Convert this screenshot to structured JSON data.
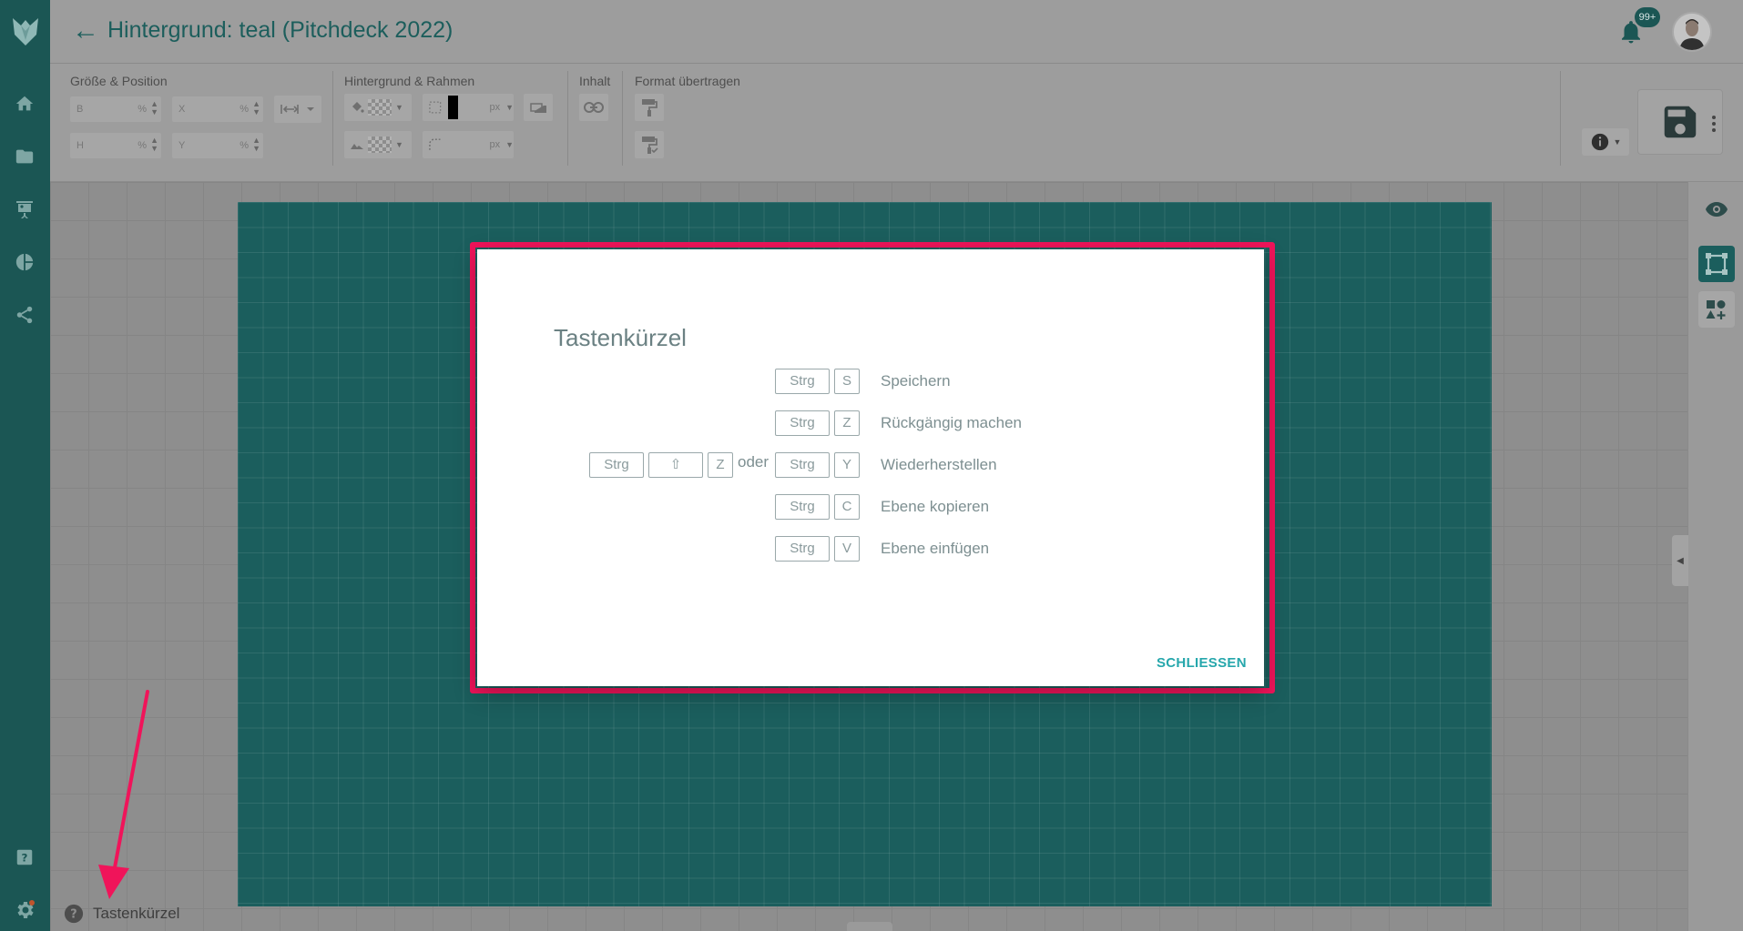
{
  "header": {
    "title": "Hintergrund: teal (Pitchdeck 2022)",
    "notification_count": "99+"
  },
  "sidebar": {
    "items": [
      {
        "icon": "home-icon"
      },
      {
        "icon": "folder-icon"
      },
      {
        "icon": "presentation-icon"
      },
      {
        "icon": "pie-chart-icon"
      },
      {
        "icon": "share-icon"
      }
    ],
    "bottom_items": [
      {
        "icon": "help-icon"
      },
      {
        "icon": "gear-icon"
      }
    ]
  },
  "toolbar": {
    "sections": {
      "size_position": "Größe & Position",
      "background_border": "Hintergrund & Rahmen",
      "content": "Inhalt",
      "format_transfer": "Format übertragen"
    },
    "fields": {
      "width_label": "B",
      "height_label": "H",
      "x_label": "X",
      "y_label": "Y",
      "percent_unit": "%",
      "px_unit": "px"
    }
  },
  "modal": {
    "title": "Tastenkürzel",
    "or_text": "oder",
    "close_label": "SCHLIESSEN",
    "shortcuts": [
      {
        "keys": [
          "Strg",
          "S"
        ],
        "label": "Speichern"
      },
      {
        "keys": [
          "Strg",
          "Z"
        ],
        "label": "Rückgängig machen"
      },
      {
        "alt_keys": [
          "Strg",
          "⇧",
          "Z"
        ],
        "keys": [
          "Strg",
          "Y"
        ],
        "label": "Wiederherstellen"
      },
      {
        "keys": [
          "Strg",
          "C"
        ],
        "label": "Ebene kopieren"
      },
      {
        "keys": [
          "Strg",
          "V"
        ],
        "label": "Ebene einfügen"
      }
    ]
  },
  "footer": {
    "shortcuts_link": "Tastenkürzel"
  },
  "colors": {
    "teal_dark": "#1b5654",
    "slide_teal": "#1b5e5d",
    "accent": "#26a7ac",
    "highlight": "#f0145a"
  }
}
